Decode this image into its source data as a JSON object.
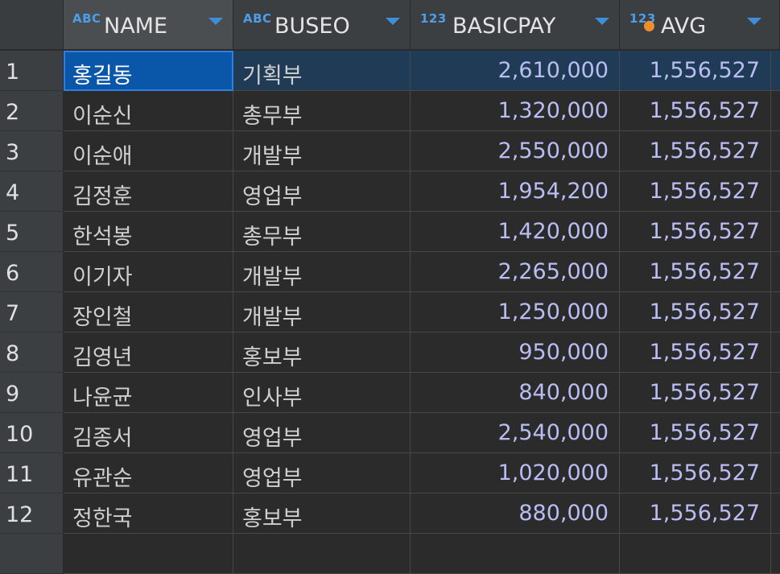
{
  "columns": [
    {
      "type_label": "ABC",
      "name": "NAME"
    },
    {
      "type_label": "ABC",
      "name": "BUSEO"
    },
    {
      "type_label": "123",
      "name": "BASICPAY"
    },
    {
      "type_label": "123",
      "name": "AVG"
    }
  ],
  "colors": {
    "background": "#2b2b2b",
    "header": "#3c3f41",
    "number_text": "#b9bdf4",
    "selection": "#1f3b55",
    "focus_cell": "#0a56a8",
    "type_label": "#4d9ee8",
    "key_dot": "#ee8f2e"
  },
  "selected_row": 1,
  "rows": [
    {
      "num": "1",
      "name": "홍길동",
      "buseo": "기획부",
      "basicpay": "2,610,000",
      "avg": "1,556,527"
    },
    {
      "num": "2",
      "name": "이순신",
      "buseo": "총무부",
      "basicpay": "1,320,000",
      "avg": "1,556,527"
    },
    {
      "num": "3",
      "name": "이순애",
      "buseo": "개발부",
      "basicpay": "2,550,000",
      "avg": "1,556,527"
    },
    {
      "num": "4",
      "name": "김정훈",
      "buseo": "영업부",
      "basicpay": "1,954,200",
      "avg": "1,556,527"
    },
    {
      "num": "5",
      "name": "한석봉",
      "buseo": "총무부",
      "basicpay": "1,420,000",
      "avg": "1,556,527"
    },
    {
      "num": "6",
      "name": "이기자",
      "buseo": "개발부",
      "basicpay": "2,265,000",
      "avg": "1,556,527"
    },
    {
      "num": "7",
      "name": "장인철",
      "buseo": "개발부",
      "basicpay": "1,250,000",
      "avg": "1,556,527"
    },
    {
      "num": "8",
      "name": "김영년",
      "buseo": "홍보부",
      "basicpay": "950,000",
      "avg": "1,556,527"
    },
    {
      "num": "9",
      "name": "나윤균",
      "buseo": "인사부",
      "basicpay": "840,000",
      "avg": "1,556,527"
    },
    {
      "num": "10",
      "name": "김종서",
      "buseo": "영업부",
      "basicpay": "2,540,000",
      "avg": "1,556,527"
    },
    {
      "num": "11",
      "name": "유관순",
      "buseo": "영업부",
      "basicpay": "1,020,000",
      "avg": "1,556,527"
    },
    {
      "num": "12",
      "name": "정한국",
      "buseo": "홍보부",
      "basicpay": "880,000",
      "avg": "1,556,527"
    },
    {
      "num": "",
      "name": "",
      "buseo": "",
      "basicpay": "",
      "avg": ""
    }
  ]
}
